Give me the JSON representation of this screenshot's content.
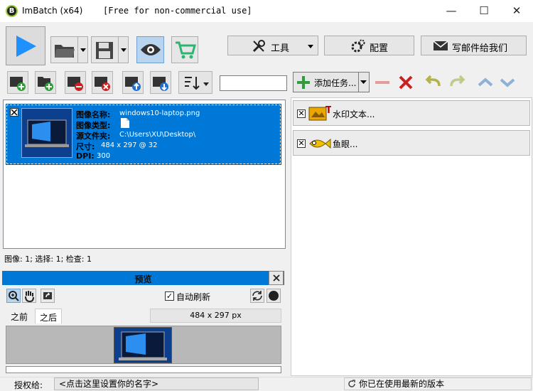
{
  "window": {
    "app_icon_letter": "B",
    "title": "ImBatch (x64)",
    "license_note": "[Free for non-commercial use]",
    "minimize_glyph": "—",
    "maximize_glyph": "☐",
    "close_glyph": "✕"
  },
  "toolbar": {
    "tools_label": "工具",
    "config_label": "配置",
    "email_label": "写邮件给我们"
  },
  "image_list": {
    "items": [
      {
        "name_label": "图像名称:",
        "name_value": "windows10-laptop.png",
        "type_label": "图像类型:",
        "folder_label": "源文件夹:",
        "folder_value": "C:\\Users\\XU\\Desktop\\",
        "size_label": "尺寸:",
        "size_value": "484 x 297 @ 32",
        "dpi_label": "DPI:",
        "dpi_value": "300",
        "checked": true
      }
    ],
    "status": "图像: 1; 选择: 1; 检查: 1"
  },
  "preview": {
    "title": "预览",
    "autorefresh_label": "自动刷新",
    "autorefresh_mark": "✓",
    "tab_before": "之前",
    "tab_after": "之后",
    "size": "484 x 297 px"
  },
  "tasks": {
    "add_label": "添加任务...",
    "items": [
      {
        "label": "水印文本...",
        "icon": "watermark-icon",
        "checked": true
      },
      {
        "label": "鱼眼...",
        "icon": "fisheye-icon",
        "checked": true
      }
    ],
    "check_mark": "✕"
  },
  "statusbar": {
    "license_label": "授权给:",
    "name_placeholder": "<点击这里设置你的名字>",
    "version_status": "你已在使用最新的版本"
  },
  "colors": {
    "accent_blue": "#0078d7",
    "play_blue": "#1e90ff",
    "cart_green": "#2bb673",
    "remove_red": "#cc1f1f"
  }
}
